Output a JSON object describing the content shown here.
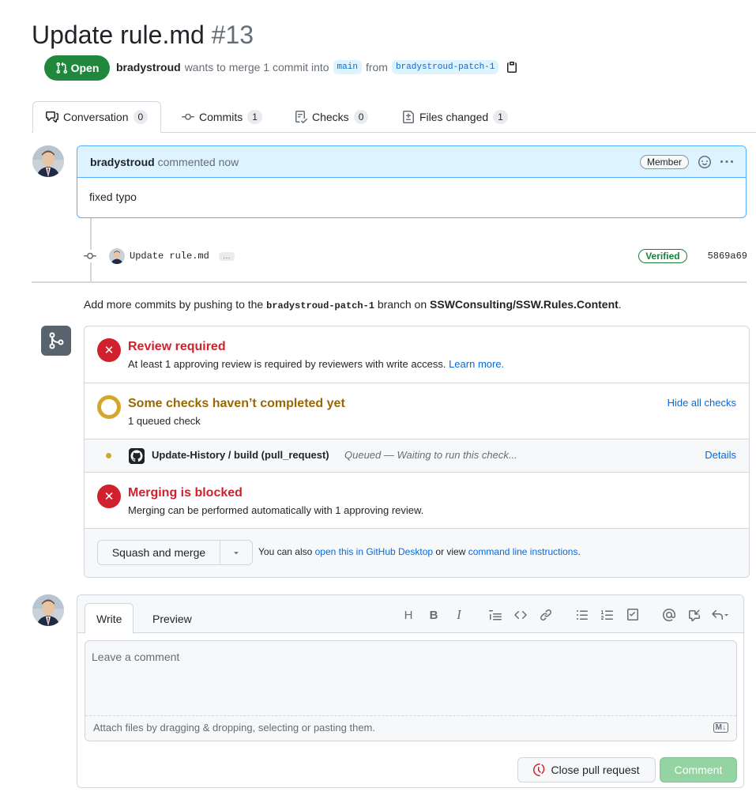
{
  "pr": {
    "title": "Update rule.md",
    "number": "#13",
    "state": "Open",
    "author": "bradystroud",
    "meta_text": "wants to merge 1 commit into",
    "base_branch": "main",
    "from_text": "from",
    "head_branch": "bradystroud-patch-1"
  },
  "tabs": [
    {
      "label": "Conversation",
      "count": "0",
      "icon": "comment-discussion-icon"
    },
    {
      "label": "Commits",
      "count": "1",
      "icon": "commit-icon"
    },
    {
      "label": "Checks",
      "count": "0",
      "icon": "checklist-icon"
    },
    {
      "label": "Files changed",
      "count": "1",
      "icon": "file-diff-icon"
    }
  ],
  "comment": {
    "author": "bradystroud",
    "action": "commented now",
    "role": "Member",
    "body": "fixed typo"
  },
  "commit": {
    "message": "Update rule.md",
    "ellipsis": "…",
    "verified": "Verified",
    "sha": "5869a69"
  },
  "hint": {
    "prefix": "Add more commits by pushing to the",
    "branch": "bradystroud-patch-1",
    "middle": "branch on",
    "repo": "SSWConsulting/SSW.Rules.Content",
    "suffix": "."
  },
  "mergebox": {
    "review": {
      "title": "Review required",
      "desc": "At least 1 approving review is required by reviewers with write access.",
      "link": "Learn more."
    },
    "checks": {
      "title": "Some checks haven’t completed yet",
      "desc": "1 queued check",
      "toggle": "Hide all checks"
    },
    "check_item": {
      "name": "Update-History / build (pull_request)",
      "status": "Queued — Waiting to run this check...",
      "details": "Details"
    },
    "blocked": {
      "title": "Merging is blocked",
      "desc": "Merging can be performed automatically with 1 approving review."
    },
    "actions": {
      "merge_button": "Squash and merge",
      "also_text": "You can also",
      "desktop_link": "open this in GitHub Desktop",
      "or_text": "or view",
      "cli_link": "command line instructions",
      "end": "."
    }
  },
  "composer": {
    "tab_write": "Write",
    "tab_preview": "Preview",
    "placeholder": "Leave a comment",
    "attach_text": "Attach files by dragging & dropping, selecting or pasting them.",
    "md_badge": "M↓",
    "close_button": "Close pull request",
    "comment_button": "Comment"
  },
  "colors": {
    "open_green": "#1f883d",
    "danger": "#cf222e",
    "pending": "#d4a72c",
    "link": "#0969da"
  }
}
